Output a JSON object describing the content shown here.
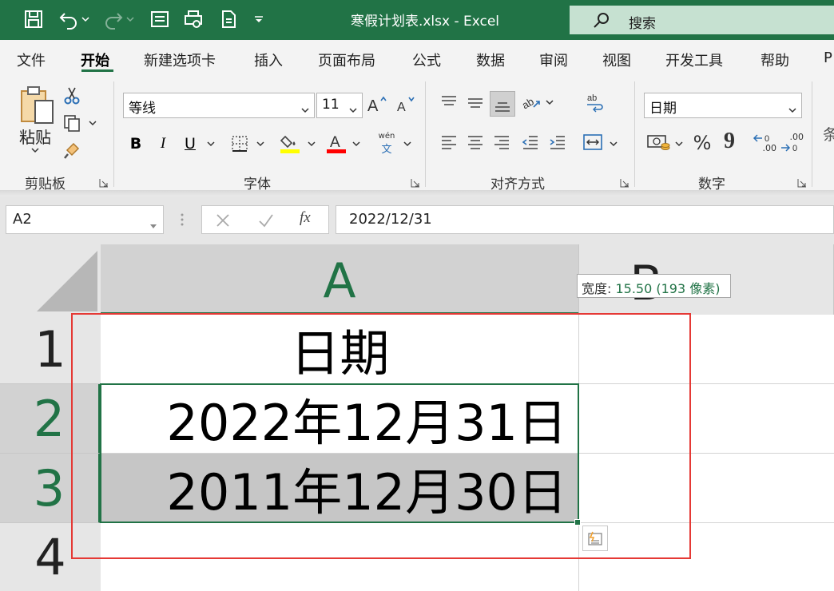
{
  "titlebar": {
    "title": "寒假计划表.xlsx  -  Excel",
    "search_label": "搜索"
  },
  "menu": {
    "tabs": [
      "文件",
      "开始",
      "新建选项卡",
      "插入",
      "页面布局",
      "公式",
      "数据",
      "审阅",
      "视图",
      "开发工具",
      "帮助",
      "P"
    ],
    "active": "开始"
  },
  "ribbon": {
    "clipboard": {
      "paste_label": "粘贴",
      "group_label": "剪贴板"
    },
    "font": {
      "font_name": "等线",
      "font_size": "11",
      "bold": "B",
      "italic": "I",
      "underline": "U",
      "phonetic_top": "wén",
      "phonetic_bottom": "文",
      "group_label": "字体",
      "fill_color": "#ffff00",
      "font_color": "#ff0000"
    },
    "alignment": {
      "group_label": "对齐方式"
    },
    "number": {
      "format": "日期",
      "percent": "%",
      "comma": "9",
      "inc_decimal": ".00",
      "dec_decimal": ".00",
      "group_label": "数字"
    },
    "styles": {
      "partial_label": "条"
    }
  },
  "formula_bar": {
    "name_box": "A2",
    "fx": "fx",
    "formula": "2022/12/31"
  },
  "sheet": {
    "columns": [
      "A",
      "B"
    ],
    "rows": [
      "1",
      "2",
      "3",
      "4"
    ],
    "cells": {
      "A1": "日期",
      "A2": "2022年12月31日",
      "A3": "2011年12月30日"
    },
    "tooltip_prefix": "宽度: ",
    "tooltip_value": "15.50 (193 像素)"
  },
  "colors": {
    "excel_green": "#217346",
    "highlight_box": "#e53935",
    "selection_fill": "#c6c6c6"
  }
}
